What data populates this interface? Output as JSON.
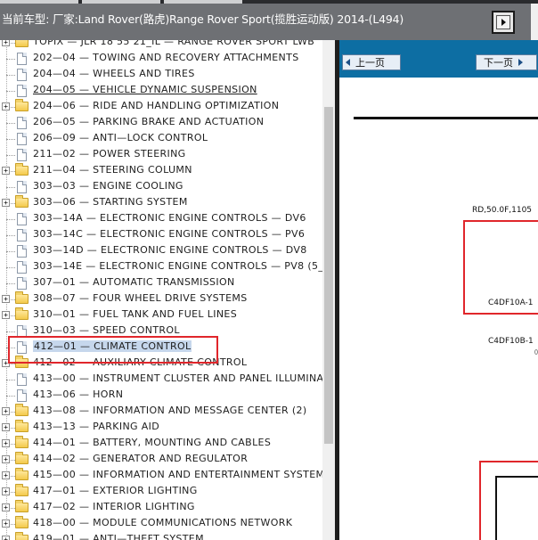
{
  "header": {
    "title": "当前车型:  厂家:Land Rover(路虎)Range Rover Sport(揽胜运动版) 2014-(L494)",
    "nav_icon": "next-page-icon"
  },
  "tree": {
    "items": [
      {
        "label": "TOPIX — JLR 18 55 21_IL — RANGE ROVER SPORT LWB",
        "type": "folder",
        "expandable": true
      },
      {
        "label": "202—04 — TOWING AND RECOVERY ATTACHMENTS",
        "type": "doc",
        "expandable": false
      },
      {
        "label": "204—04 — WHEELS AND TIRES",
        "type": "doc",
        "expandable": false
      },
      {
        "label": "204—05 — VEHICLE DYNAMIC SUSPENSION",
        "type": "doc",
        "expandable": false,
        "link": true
      },
      {
        "label": "204—06 — RIDE AND HANDLING OPTIMIZATION",
        "type": "folder",
        "expandable": true
      },
      {
        "label": "206—05 — PARKING BRAKE AND ACTUATION",
        "type": "doc",
        "expandable": false
      },
      {
        "label": "206—09 — ANTI—LOCK CONTROL",
        "type": "doc",
        "expandable": false
      },
      {
        "label": "211—02 — POWER STEERING",
        "type": "doc",
        "expandable": false
      },
      {
        "label": "211—04 — STEERING COLUMN",
        "type": "folder",
        "expandable": true
      },
      {
        "label": "303—03 — ENGINE COOLING",
        "type": "doc",
        "expandable": false
      },
      {
        "label": "303—06 — STARTING SYSTEM",
        "type": "folder",
        "expandable": true
      },
      {
        "label": "303—14A — ELECTRONIC ENGINE CONTROLS — DV6",
        "type": "doc",
        "expandable": false
      },
      {
        "label": "303—14C — ELECTRONIC ENGINE CONTROLS — PV6",
        "type": "doc",
        "expandable": false
      },
      {
        "label": "303—14D — ELECTRONIC ENGINE CONTROLS — DV8",
        "type": "doc",
        "expandable": false
      },
      {
        "label": "303—14E — ELECTRONIC ENGINE CONTROLS — PV8 (5_",
        "type": "doc",
        "expandable": false
      },
      {
        "label": "307—01 — AUTOMATIC TRANSMISSION",
        "type": "doc",
        "expandable": false
      },
      {
        "label": "308—07 — FOUR WHEEL DRIVE SYSTEMS",
        "type": "folder",
        "expandable": true
      },
      {
        "label": "310—01 — FUEL TANK AND FUEL LINES",
        "type": "folder",
        "expandable": true
      },
      {
        "label": "310—03 — SPEED CONTROL",
        "type": "doc",
        "expandable": false
      },
      {
        "label": "412—01 — CLIMATE CONTROL",
        "type": "doc",
        "expandable": false,
        "selected": true
      },
      {
        "label": "412—02 — AUXILIARY CLIMATE CONTROL",
        "type": "folder",
        "expandable": true
      },
      {
        "label": "413—00 — INSTRUMENT CLUSTER AND PANEL ILLUMINA",
        "type": "doc",
        "expandable": false
      },
      {
        "label": "413—06 — HORN",
        "type": "doc",
        "expandable": false
      },
      {
        "label": "413—08 — INFORMATION AND MESSAGE CENTER (2)",
        "type": "folder",
        "expandable": true
      },
      {
        "label": "413—13 — PARKING AID",
        "type": "folder",
        "expandable": true
      },
      {
        "label": "414—01 — BATTERY, MOUNTING AND CABLES",
        "type": "folder",
        "expandable": true
      },
      {
        "label": "414—02 — GENERATOR AND REGULATOR",
        "type": "folder",
        "expandable": true
      },
      {
        "label": "415—00 — INFORMATION AND ENTERTAINMENT SYSTEM",
        "type": "folder",
        "expandable": true
      },
      {
        "label": "417—01 — EXTERIOR LIGHTING",
        "type": "folder",
        "expandable": true
      },
      {
        "label": "417—02 — INTERIOR LIGHTING",
        "type": "folder",
        "expandable": true
      },
      {
        "label": "418—00 — MODULE COMMUNICATIONS NETWORK",
        "type": "folder",
        "expandable": true
      },
      {
        "label": "419—01 — ANTI—THEFT SYSTEM",
        "type": "folder",
        "expandable": true
      }
    ]
  },
  "diagram": {
    "prev_label": "上一页",
    "next_label": "下一页",
    "labels": {
      "top": "RD,50.0F,1105",
      "connector_a": "C4DF10A-1",
      "connector_b": "C4DF10B-1"
    },
    "highlight_color": "#e0262b"
  },
  "colors": {
    "header_bg": "#6e7074",
    "diagram_nav_bg": "#0d6ea3",
    "selection_bg": "#c6d7ec",
    "annotation_red": "#e0262b"
  }
}
